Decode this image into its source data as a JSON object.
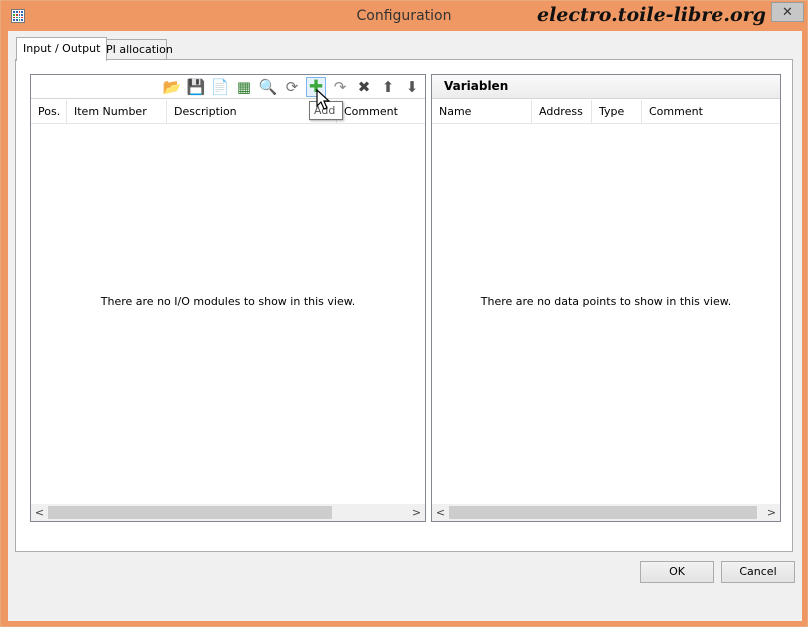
{
  "window": {
    "title": "Configuration",
    "watermark": "electro.toile-libre.org",
    "close_label": "✕"
  },
  "tabs": [
    {
      "label": "Input / Output",
      "active": true
    },
    {
      "label": "PI allocation",
      "active": false
    }
  ],
  "left_pane": {
    "toolbar": [
      {
        "icon": "open-folder-icon",
        "glyph": "📂"
      },
      {
        "icon": "save-icon",
        "glyph": "💾"
      },
      {
        "icon": "document-icon",
        "glyph": "📄"
      },
      {
        "icon": "module-grid-icon",
        "glyph": "▦"
      },
      {
        "icon": "search-icon",
        "glyph": "🔍"
      },
      {
        "icon": "refresh-icon",
        "glyph": "⟳"
      },
      {
        "icon": "add-icon",
        "glyph": "✚"
      },
      {
        "icon": "redo-icon",
        "glyph": "↷"
      },
      {
        "icon": "delete-icon",
        "glyph": "✖"
      },
      {
        "icon": "move-up-icon",
        "glyph": "⬆"
      },
      {
        "icon": "move-down-icon",
        "glyph": "⬇"
      }
    ],
    "columns": [
      "Pos.",
      "Item Number",
      "Description",
      "Comment"
    ],
    "empty_message": "There are no I/O modules to show in this view."
  },
  "right_pane": {
    "title": "Variablen",
    "columns": [
      "Name",
      "Address",
      "Type",
      "Comment"
    ],
    "empty_message": "There are no data points to show in this view."
  },
  "tooltip": "Add",
  "scroll_arrows": {
    "left": "<",
    "right": ">"
  },
  "buttons": {
    "ok": "OK",
    "cancel": "Cancel"
  },
  "colors": {
    "titlebar": "#f09863",
    "add_icon": "#3aa83a",
    "hover_border": "#7eb4ea"
  }
}
